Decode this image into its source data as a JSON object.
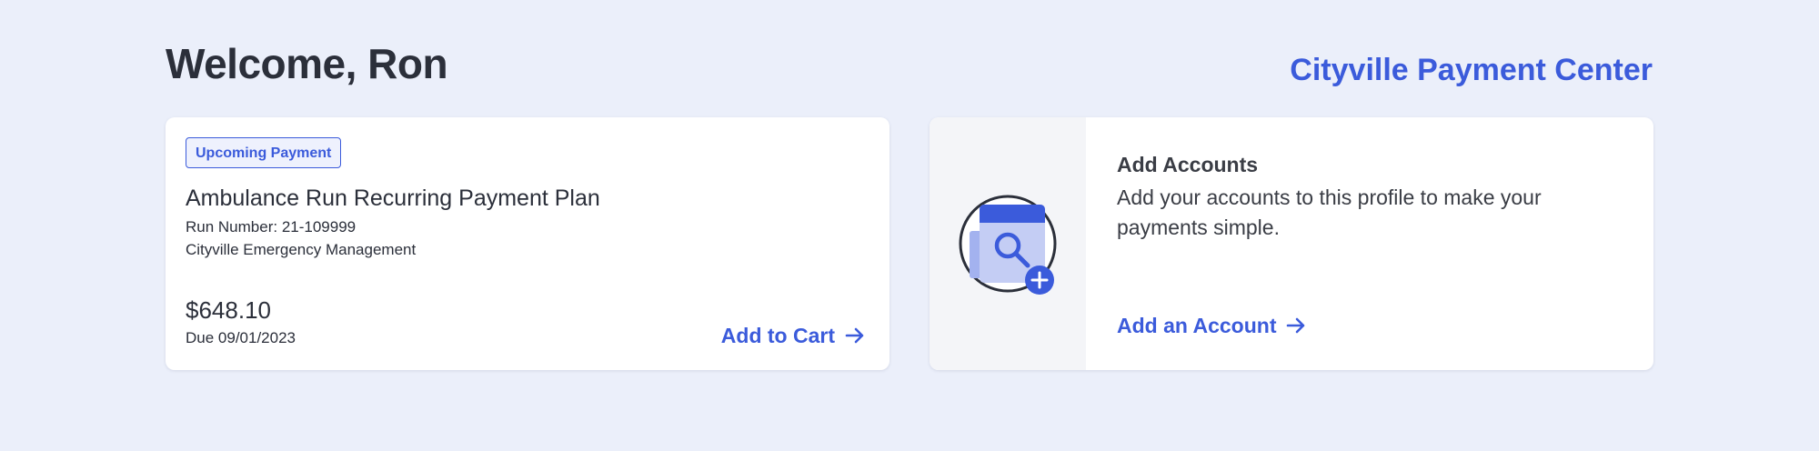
{
  "header": {
    "welcome": "Welcome, Ron",
    "brand": "Cityville Payment Center"
  },
  "payment_card": {
    "badge": "Upcoming Payment",
    "title": "Ambulance Run Recurring Payment Plan",
    "run_number": "Run Number: 21-109999",
    "organization": "Cityville Emergency Management",
    "amount": "$648.10",
    "due": "Due 09/01/2023",
    "action": "Add to Cart"
  },
  "accounts_card": {
    "title": "Add Accounts",
    "description": "Add your accounts to this profile to make your payments simple.",
    "action": "Add an Account"
  },
  "icons": {
    "arrow": "arrow-right-icon",
    "illustration": "add-accounts-search-document-icon",
    "plus": "plus-icon"
  },
  "colors": {
    "background": "#ebeffa",
    "accent": "#3b5bdb",
    "text": "#2b2f3a",
    "card": "#ffffff",
    "illustration_light": "#c4cdf4",
    "illustration_mid": "#a3b2ef"
  }
}
